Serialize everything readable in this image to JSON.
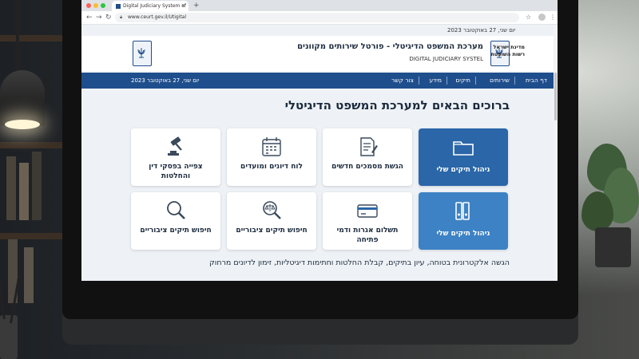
{
  "browser": {
    "tab_title": "Digital Judiciary System of",
    "tab_close": "×",
    "new_tab": "+",
    "back": "←",
    "forward": "→",
    "reload": "↻",
    "url": "www.ceurt.gev.il/Utigital",
    "star": "☆",
    "menu": "⋮"
  },
  "page": {
    "top_date": "יום שני, 27 באוקטובר 2023",
    "header": {
      "title": "מערכת המשפט הדיגיטלי - פורטל שירותים מקוונים",
      "subtitle": "DIGITAL JUDICIARY SYSTEL",
      "state_line1": "מדינת ישראל",
      "state_line2": "רשות השופטת"
    },
    "nav": {
      "items": [
        {
          "label": "דף הבית"
        },
        {
          "label": "שירותים"
        },
        {
          "label": "תיקים"
        },
        {
          "label": "מידע"
        },
        {
          "label": "צור קשר"
        }
      ],
      "date": "יום שני, 27 באוקטובר 2023"
    },
    "welcome": "ברוכים הבאים למערכת המשפט הדיגיטלי",
    "cards": [
      {
        "label": "ניהול תיקים שלי",
        "icon": "folder-icon"
      },
      {
        "label": "הגשת מסמכים חדשים",
        "icon": "document-pen-icon"
      },
      {
        "label": "לוח דיונים ומועדים",
        "icon": "calendar-icon"
      },
      {
        "label": "צפייה בפסקי דין והחלטות",
        "icon": "gavel-icon"
      },
      {
        "label": "ניהול תיקים שלי",
        "icon": "binders-icon"
      },
      {
        "label": "תשלום אגרות ודמי פתיחה",
        "icon": "credit-card-icon"
      },
      {
        "label": "חיפוש תיקים ציבוריים",
        "icon": "search-scales-icon"
      },
      {
        "label": "חיפוש תיקים ציבוריים",
        "icon": "search-icon"
      }
    ],
    "footer": "הגשה אלקטרונית בטוחה, עיון בתיקים, קבלת החלטות וחתימות דיגיטליות, זימון לדיונים מרחוק"
  },
  "colors": {
    "primary": "#1f4e8c",
    "card_primary": "#2a66a8",
    "card_primary_light": "#3d82c4",
    "text_dark": "#1b2a3d"
  }
}
